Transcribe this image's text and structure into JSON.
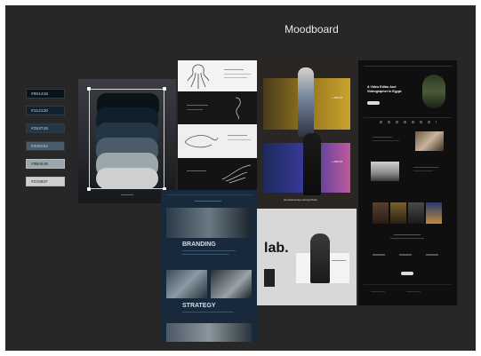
{
  "board": {
    "title": "Moodboard"
  },
  "palette": {
    "colors": [
      "#081418",
      "#11212D",
      "#253745",
      "#4A5C6A",
      "#9BA8AB",
      "#CCD0CF"
    ],
    "labels": [
      "#06141B",
      "#11212D",
      "#253745",
      "#4A5C6A",
      "#9BA8AB",
      "#CCD0CF"
    ]
  },
  "branding_panel": {
    "heading_branding": "BRANDING",
    "heading_strategy": "STRATEGY"
  },
  "fashion_panel": {
    "caption": "showcaseinspo.dev/portfolio",
    "about_label_1": "+ ABOUT",
    "about_label_2": "+ ABOUT"
  },
  "lab_panel": {
    "logo_text": "lab."
  },
  "portfolio_panel": {
    "headline_line1": "A Video Editor And",
    "headline_line2": "Videographer in Egypt."
  }
}
